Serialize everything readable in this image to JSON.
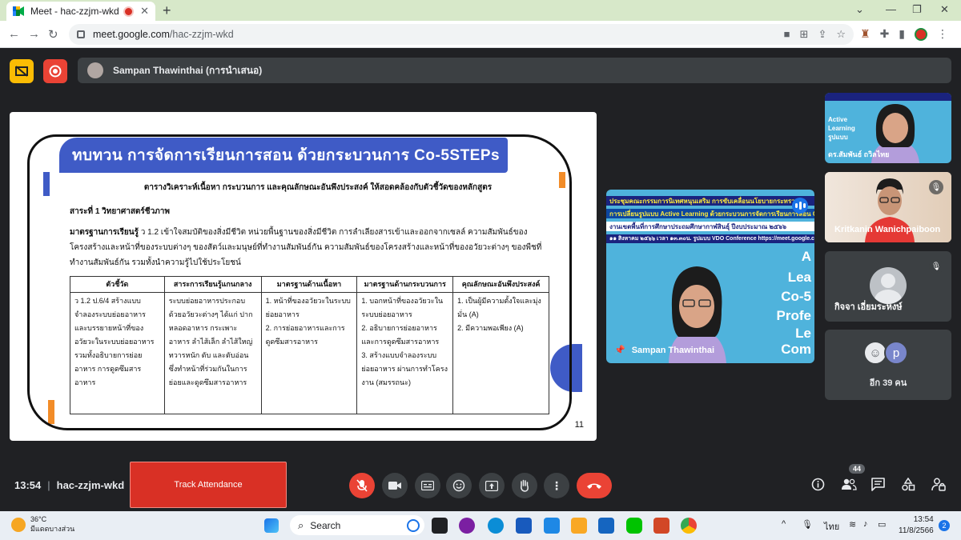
{
  "browser": {
    "tab_title": "Meet - hac-zzjm-wkd",
    "tab_close": "✕",
    "new_tab": "+",
    "url_host": "meet.google.com",
    "url_path": "/hac-zzjm-wkd",
    "window_controls": [
      "⌄",
      "—",
      "❐",
      "✕"
    ],
    "nav": {
      "back": "←",
      "forward": "→",
      "reload": "↻"
    },
    "more_menu": "⋮"
  },
  "meet": {
    "presenter_bar_text": "Sampan Thawinthai (การนำเสนอ)",
    "meeting_time": "13:54",
    "meeting_code": "hac-zzjm-wkd",
    "track_attendance_label": "Track Attendance",
    "people_count": "44",
    "accent_red": "#ea4335"
  },
  "slide": {
    "title": "ทบทวน การจัดการเรียนการสอน ด้วยกระบวนการ Co-5STEPs",
    "subtitle": "ตารางวิเคราะห์เนื้อหา กระบวนการ และคุณลักษณะอันพึงประสงค์ ให้สอดคล้องกับตัวชี้วัดของหลักสูตร",
    "unit": "สาระที่ 1  วิทยาศาสตร์ชีวภาพ",
    "standard_label": "มาตรฐานการเรียนรู้",
    "standard_text": " ว 1.2 เข้าใจสมบัติของสิ่งมีชีวิต หน่วยพื้นฐานของสิ่งมีชีวิต การลำเลียงสารเข้าและออกจากเซลล์ ความสัมพันธ์ของโครงสร้างและหน้าที่ของระบบต่างๆ ของสัตว์และมนุษย์ที่ทำงานสัมพันธ์กัน ความสัมพันธ์ของโครงสร้างและหน้าที่ของอวัยวะต่างๆ ของพืชที่ทำงานสัมพันธ์กัน รวมทั้งนำความรู้ไปใช้ประโยชน์",
    "table_headers": [
      "ตัวชี้วัด",
      "สาระการเรียนรู้แกนกลาง",
      "มาตรฐานด้านเนื้อหา",
      "มาตรฐานด้านกระบวนการ",
      "คุณลักษณะอันพึงประสงค์"
    ],
    "table_row": [
      "ว 1.2 ป.6/4 สร้างแบบจำลองระบบย่อยอาหาร และบรรยายหน้าที่ของอวัยวะในระบบย่อยอาหาร รวมทั้งอธิบายการย่อยอาหาร การดูดซึมสารอาหาร",
      "ระบบย่อยอาหารประกอบด้วยอวัยวะต่างๆ ได้แก่ ปาก หลอดอาหาร กระเพาะอาหาร ลำไส้เล็ก ลำไส้ใหญ่ ทวารหนัก ตับ และตับอ่อน ซึ่งทำหน้าที่ร่วมกันในการย่อยและดูดซึมสารอาหาร",
      "1.  หน้าที่ของอวัยวะในระบบย่อยอาหาร\n2.  การย่อยอาหารและการดูดซึมสารอาหาร",
      "1. บอกหน้าที่ของอวัยวะในระบบย่อยอาหาร\n2. อธิบายการย่อยอาหารและการดูดซึมสารอาหาร\n3. สร้างแบบจำลองระบบย่อยอาหาร ผ่านการทำโครงงาน (สมรรถนะ)",
      "1. เป็นผู้มีความตั้งใจและมุ่งมั่น (A)\n2. มีความพอเพียง (A)"
    ],
    "page_mark": "11",
    "accent_blue": "#3f5bc6",
    "accent_orange": "#f28c28"
  },
  "speaker_tile": {
    "strip1": "ประชุมคณะกรรมการนิเทศหนุนเสริม การขับเคลื่อนนโยบายกระทรวง",
    "strip2": "การเปลี่ยนรูปแบบ Active Learning  ด้วยกระบวนการจัดการเรียนการสอน Co",
    "strip3": "งานเขตพื้นที่การศึกษาประถมศึกษากาฬสินธุ์  ปีงบประมาณ ๒๕๖๖",
    "strip4": "๑๑ สิงหาคม ๒๕๖๖ เวลา ๑๓.๓๐น. รูปแบบ VDO Conference https://meet.google.com",
    "big_lines": [
      "A",
      "Lea",
      "Co-5",
      "Profe",
      "Le",
      "Com"
    ],
    "name": "Sampan Thawinthai"
  },
  "side_tiles": {
    "tile1_lines": [
      "Active",
      "Learning",
      "รูปแบบ",
      "ดร.สัมพันธ์ ถวิลไทย"
    ],
    "tile2_name": "Kritkanin Wanichpaiboon",
    "tile3_name": "กิจจา เอี่ยมระหงษ์",
    "more_label": "อีก 39 คน",
    "more_avatar_letter": "p"
  },
  "taskbar": {
    "weather_temp": "36°C",
    "weather_desc": "มีแดดบางส่วน",
    "search_placeholder": "Search",
    "lang": "ไทย",
    "time": "13:54",
    "date": "11/8/2566",
    "notifications": "2"
  }
}
